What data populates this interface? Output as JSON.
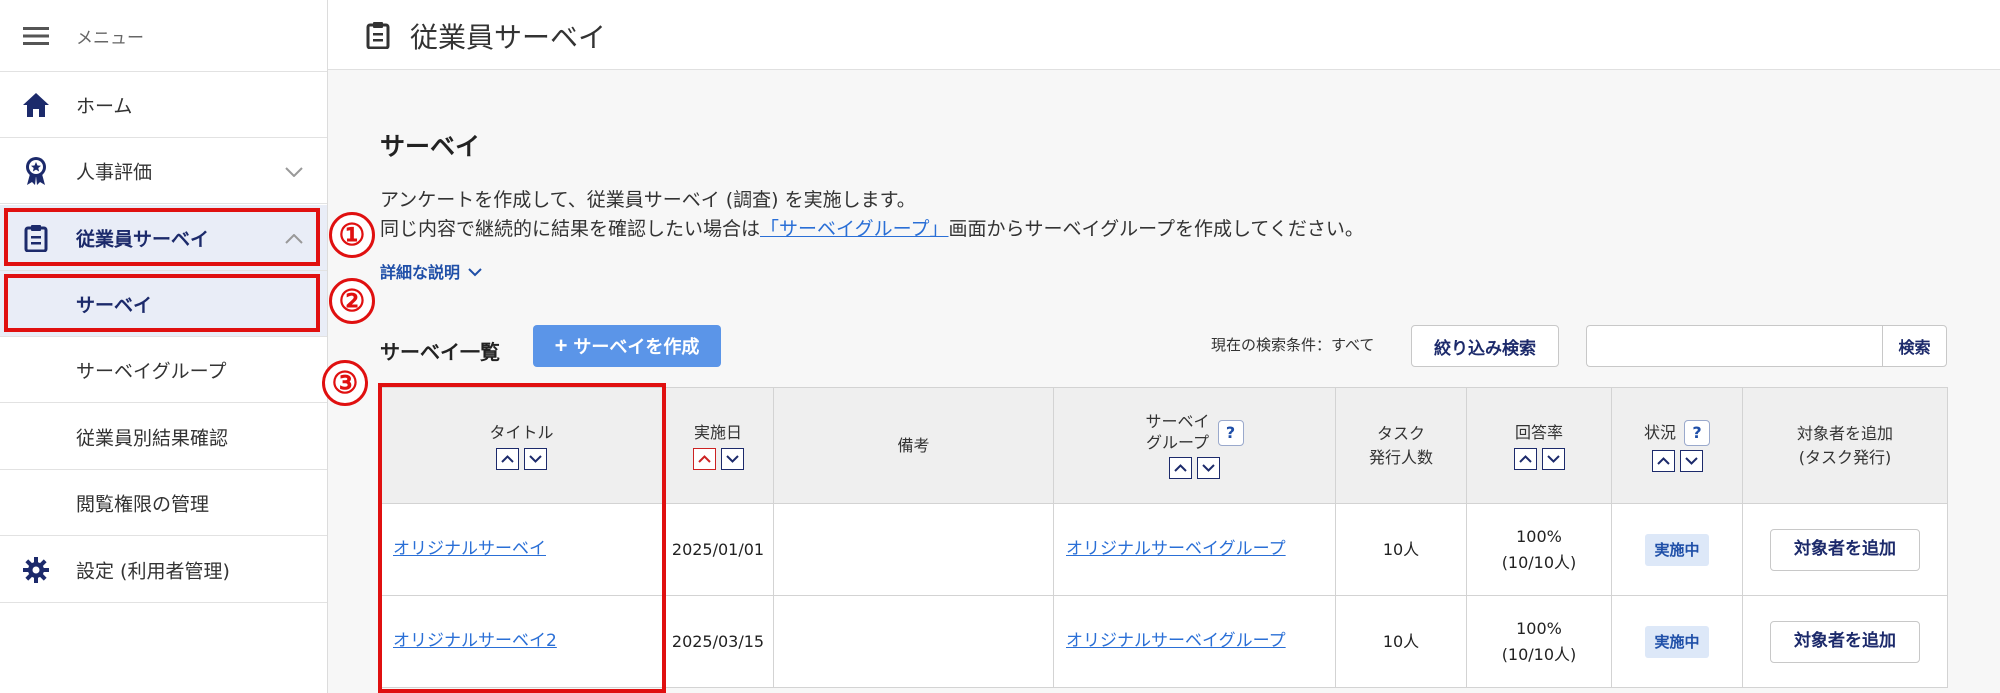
{
  "sidebar": {
    "menu_label": "メニュー",
    "items": [
      {
        "label": "ホーム",
        "icon": "home-icon"
      },
      {
        "label": "人事評価",
        "icon": "award-icon"
      },
      {
        "label": "従業員サーベイ",
        "icon": "clipboard-icon"
      },
      {
        "label": "サーベイ"
      },
      {
        "label": "サーベイグループ"
      },
      {
        "label": "従業員別結果確認"
      },
      {
        "label": "閲覧権限の管理"
      },
      {
        "label": "設定 (利用者管理)",
        "icon": "gear-icon"
      }
    ]
  },
  "header": {
    "title": "従業員サーベイ"
  },
  "main": {
    "section_title": "サーベイ",
    "desc_line1": "アンケートを作成して、従業員サーベイ (調査) を実施します。",
    "desc_line2_pre": "同じ内容で継続的に結果を確認したい場合は",
    "desc_line2_link": "「サーベイグループ」",
    "desc_line2_post": "画面からサーベイグループを作成してください。",
    "detail_link": "詳細な説明",
    "list_title": "サーベイ一覧",
    "create_button": "サーベイを作成",
    "search_condition": "現在の検索条件：すべて",
    "filter_button": "絞り込み検索",
    "search_placeholder": "",
    "search_button": "検索"
  },
  "table": {
    "headers": {
      "title": "タイトル",
      "date": "実施日",
      "note": "備考",
      "group_line1": "サーベイ",
      "group_line2": "グループ",
      "task_line1": "タスク",
      "task_line2": "発行人数",
      "rate": "回答率",
      "status": "状況",
      "add_line1": "対象者を追加",
      "add_line2": "(タスク発行)"
    },
    "rows": [
      {
        "title": "オリジナルサーベイ",
        "date": "2025/01/01",
        "note": "",
        "group": "オリジナルサーベイグループ",
        "task": "10人",
        "rate": "100%",
        "rate_detail": "(10/10人)",
        "status": "実施中",
        "add": "対象者を追加"
      },
      {
        "title": "オリジナルサーベイ2",
        "date": "2025/03/15",
        "note": "",
        "group": "オリジナルサーベイグループ",
        "task": "10人",
        "rate": "100%",
        "rate_detail": "(10/10人)",
        "status": "実施中",
        "add": "対象者を追加"
      }
    ]
  },
  "annotations": {
    "n1": "①",
    "n2": "②",
    "n3": "③"
  },
  "colors": {
    "accent": "#1c2a6b",
    "link": "#2a6fd6",
    "primary_button": "#5b95e8",
    "highlight": "#e01010"
  }
}
